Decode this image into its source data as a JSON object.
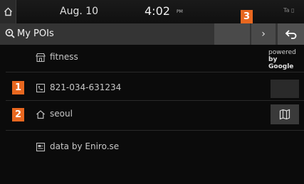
{
  "status_bar": {
    "date": "Aug. 10",
    "time": "4:02",
    "ampm": "PM",
    "signal_text": "Ta ▯"
  },
  "header": {
    "title": "My POIs",
    "next_symbol": "›",
    "back_icon": "back-arrow-icon"
  },
  "markers": [
    "1",
    "2",
    "3"
  ],
  "rows": [
    {
      "icon": "store-icon",
      "text": "fitness"
    },
    {
      "icon": "phone-icon",
      "text": "821-034-631234"
    },
    {
      "icon": "home-icon",
      "text": "seoul"
    },
    {
      "icon": "data-icon",
      "text": "data by Eniro.se"
    }
  ],
  "powered_by": {
    "line1": "powered",
    "line2": "by Google"
  },
  "colors": {
    "marker": "#e8671f",
    "background": "#0b0b0b",
    "header": "#343434"
  }
}
